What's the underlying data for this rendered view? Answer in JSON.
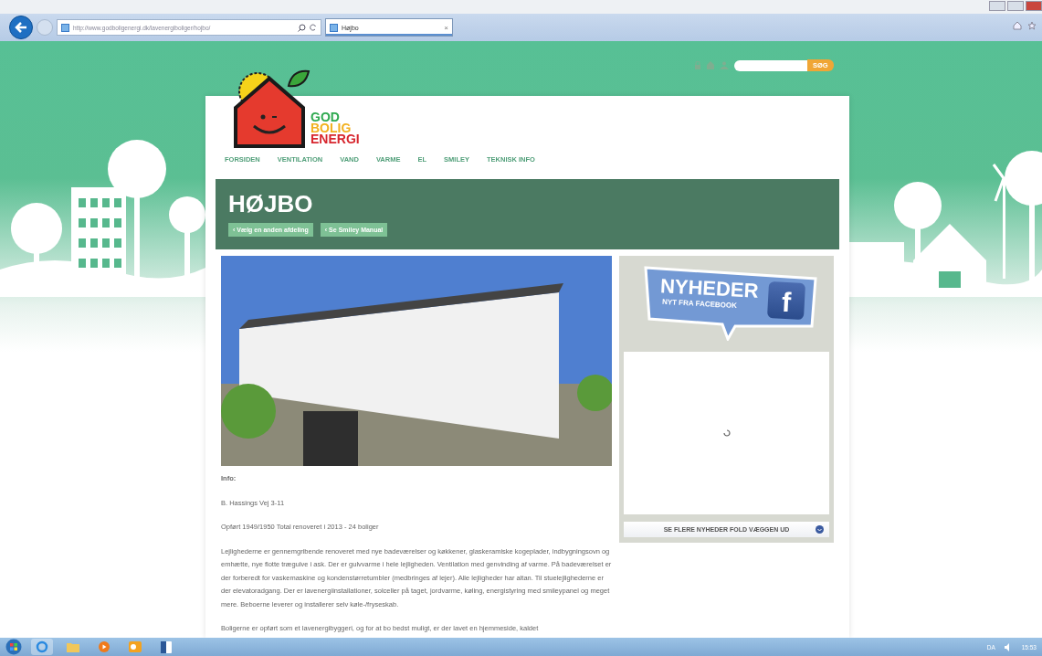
{
  "browser": {
    "url": "http://www.godboligenergi.dk/lavenergiboliger/hojbo/",
    "tab": {
      "title": "Højbo",
      "close": "×",
      "selected": true
    }
  },
  "site_search": {
    "button": "SØG"
  },
  "logo": {
    "lines": [
      {
        "text": "GOD",
        "color": "#2ea94f"
      },
      {
        "text": "BOLIG",
        "color": "#f2b01e"
      },
      {
        "text": "ENERGI",
        "color": "#d7262e"
      }
    ]
  },
  "nav": [
    {
      "label": "FORSIDEN"
    },
    {
      "label": "VENTILATION"
    },
    {
      "label": "VAND"
    },
    {
      "label": "VARME"
    },
    {
      "label": "EL"
    },
    {
      "label": "SMILEY"
    },
    {
      "label": "TEKNISK INFO"
    }
  ],
  "header": {
    "title": "HØJBO",
    "buttons": [
      "‹ Vælg en anden afdeling",
      "‹ Se Smiley Manual"
    ]
  },
  "info": {
    "heading": "Info:",
    "paragraphs": [
      "B. Hassings Vej 3-11",
      "Opført 1949/1950 Total renoveret i 2013 - 24 boliger",
      "Lejlighederne er gennemgribende renoveret med nye badeværelser og køkkener, glaskeramiske kogeplader, indbygningsovn og emhætte, nye flotte trægulve i ask. Der er gulvvarme i hele lejligheden. Ventilation med genvinding af varme. På badeværelset er der forberedt for vaskemaskine og kondenstørretumbler (medbringes af lejer). Alle lejligheder har altan. Til stuelejlighederne er der elevatoradgang. Der er lavenergiinstallationer, solceller på taget, jordvarme, køling,  energistyring med smileypanel og meget mere. Beboerne leverer og installerer selv køle-/fryseskab.",
      "Boligerne er opført som et lavenergibyggeri, og for at bo bedst muligt, er der lavet en hjemmeside, kaldet"
    ]
  },
  "news": {
    "title": "NYHEDER",
    "subtitle": "NYT FRA FACEBOOK",
    "badge": "f",
    "more_link": "SE FLERE NYHEDER FOLD VÆGGEN UD"
  },
  "taskbar": {
    "language": "DA",
    "clock": "15:53"
  }
}
